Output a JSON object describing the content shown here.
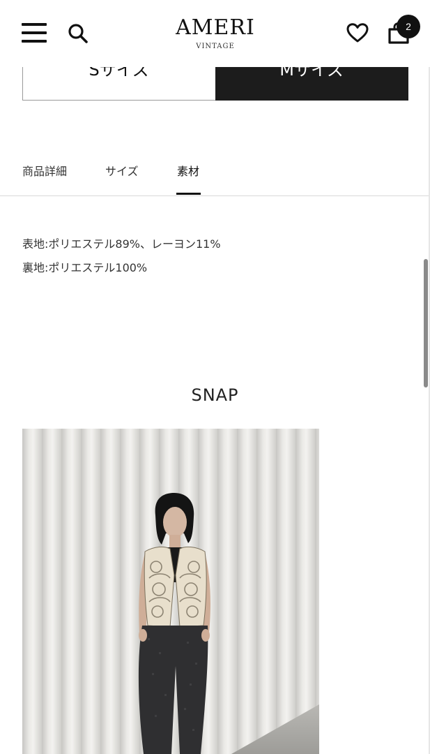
{
  "header": {
    "logo_main": "AMERI",
    "logo_sub": "VINTAGE",
    "cart_count": "2"
  },
  "size_selector": {
    "options": [
      "Sサイズ",
      "Mサイズ"
    ],
    "selected": "Mサイズ"
  },
  "tabs": {
    "items": [
      "商品詳細",
      "サイズ",
      "素材"
    ],
    "active": "素材"
  },
  "material": {
    "lines": [
      "表地:ポリエステル89%、レーヨン11%",
      "裏地:ポリエステル100%"
    ]
  },
  "snap": {
    "title": "SNAP"
  },
  "colors": {
    "accent": "#1c1c1c",
    "divider": "#d8d8d8",
    "text": "#333333"
  },
  "icons": {
    "menu": "hamburger-icon",
    "search": "search-icon",
    "wishlist": "heart-icon",
    "cart": "shopping-bag-icon"
  }
}
